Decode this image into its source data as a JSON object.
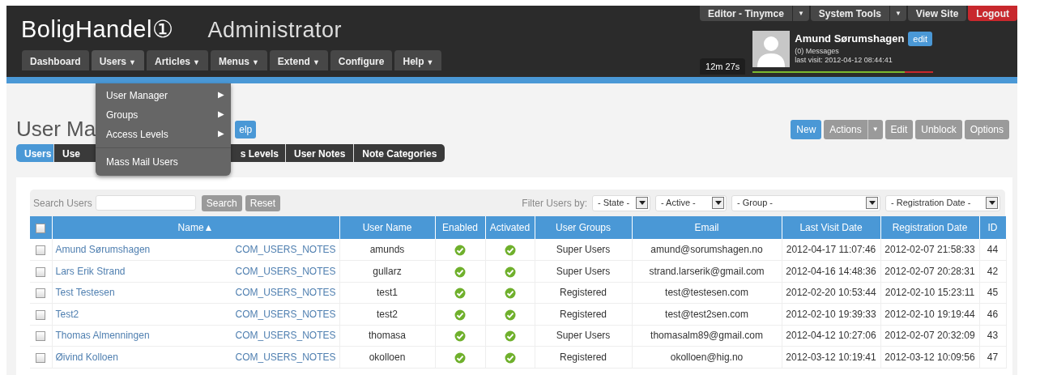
{
  "header": {
    "logo": "BoligHandel①",
    "subtitle": "Administrator",
    "top_buttons": [
      {
        "label": "Editor - Tinymce",
        "kind": "split",
        "caret": "▼"
      },
      {
        "label": "System Tools",
        "kind": "split",
        "caret": "▼"
      },
      {
        "label": "View Site",
        "kind": "plain"
      },
      {
        "label": "Logout",
        "kind": "danger"
      }
    ],
    "user": {
      "name": "Amund Sørumshagen",
      "edit": "edit",
      "messages": "(0) Messages",
      "last_visit": "last visit: 2012-04-12 08:44:41",
      "timer": "12m 27s",
      "session": {
        "level": 0.84
      }
    },
    "menu": [
      {
        "label": "Dashboard",
        "open": false
      },
      {
        "label": "Users",
        "caret": "▼",
        "open": true
      },
      {
        "label": "Articles",
        "caret": "▼",
        "open": false
      },
      {
        "label": "Menus",
        "caret": "▼",
        "open": false
      },
      {
        "label": "Extend",
        "caret": "▼",
        "open": false
      },
      {
        "label": "Configure",
        "open": false
      },
      {
        "label": "Help",
        "caret": "▼",
        "open": false
      }
    ],
    "dropdown": [
      {
        "label": "User Manager",
        "arrow": "▶",
        "divider_before": false
      },
      {
        "label": "Groups",
        "arrow": "▶",
        "divider_before": false
      },
      {
        "label": "Access Levels",
        "arrow": "▶",
        "divider_before": false
      },
      {
        "label": "Mass Mail Users",
        "divider_before": true
      }
    ]
  },
  "page_title": "User Ma",
  "help": "elp",
  "subtabs": [
    {
      "label": "Users",
      "selected": true
    },
    {
      "label": "Use",
      "selected": false
    },
    {
      "label": "s Levels",
      "selected": false
    },
    {
      "label": "User Notes",
      "selected": false
    },
    {
      "label": "Note Categories",
      "selected": false
    }
  ],
  "toolbar": [
    {
      "label": "New",
      "kind": "primary"
    },
    {
      "label": "Actions",
      "kind": "split",
      "caret": "▼"
    },
    {
      "label": "Edit",
      "kind": "plain"
    },
    {
      "label": "Unblock",
      "kind": "plain"
    },
    {
      "label": "Options",
      "kind": "plain"
    }
  ],
  "search": {
    "label": "Search Users",
    "search": "Search",
    "reset": "Reset"
  },
  "filters": {
    "label": "Filter Users by:",
    "selects": [
      "- State -",
      "- Active -",
      "- Group -",
      "- Registration Date -"
    ]
  },
  "table": {
    "select_all": {
      "checked": false
    },
    "columns": [
      "Name▲",
      "User Name",
      "Enabled",
      "Activated",
      "User Groups",
      "Email",
      "Last Visit Date",
      "Registration Date",
      "ID"
    ],
    "rows": [
      {
        "checked": false,
        "name": "Amund Sørumshagen",
        "notes": "COM_USERS_NOTES",
        "username": "amunds",
        "enabled": true,
        "activated": true,
        "group": "Super Users",
        "email": "amund@sorumshagen.no",
        "last_visit": "2012-04-17 11:07:46",
        "registered": "2012-02-07 21:58:33",
        "id": "44"
      },
      {
        "checked": false,
        "name": "Lars Erik Strand",
        "notes": "COM_USERS_NOTES",
        "username": "gullarz",
        "enabled": true,
        "activated": true,
        "group": "Super Users",
        "email": "strand.larserik@gmail.com",
        "last_visit": "2012-04-16 14:48:36",
        "registered": "2012-02-07 20:28:31",
        "id": "42"
      },
      {
        "checked": false,
        "name": "Test Testesen",
        "notes": "COM_USERS_NOTES",
        "username": "test1",
        "enabled": true,
        "activated": true,
        "group": "Registered",
        "email": "test@testesen.com",
        "last_visit": "2012-02-20 10:53:44",
        "registered": "2012-02-10 15:23:11",
        "id": "45"
      },
      {
        "checked": false,
        "name": "Test2",
        "notes": "COM_USERS_NOTES",
        "username": "test2",
        "enabled": true,
        "activated": true,
        "group": "Registered",
        "email": "test@test2sen.com",
        "last_visit": "2012-02-10 19:39:33",
        "registered": "2012-02-10 19:19:44",
        "id": "46"
      },
      {
        "checked": false,
        "name": "Thomas Almenningen",
        "notes": "COM_USERS_NOTES",
        "username": "thomasa",
        "enabled": true,
        "activated": true,
        "group": "Super Users",
        "email": "thomasalm89@gmail.com",
        "last_visit": "2012-04-12 10:27:06",
        "registered": "2012-02-07 20:32:09",
        "id": "43"
      },
      {
        "checked": false,
        "name": "Øivind Kolloen",
        "notes": "COM_USERS_NOTES",
        "username": "okolloen",
        "enabled": true,
        "activated": true,
        "group": "Registered",
        "email": "okolloen@hig.no",
        "last_visit": "2012-03-12 10:19:41",
        "registered": "2012-03-12 10:09:56",
        "id": "47"
      }
    ]
  }
}
